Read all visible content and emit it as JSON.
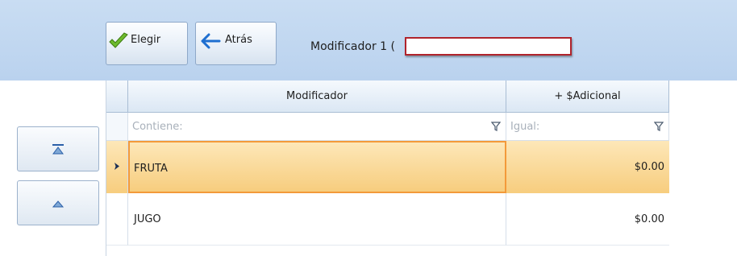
{
  "toolbar": {
    "elegir_label": "Elegir",
    "elegir_icon": "checkmark-icon",
    "atras_label": "Atrás",
    "atras_icon": "arrow-left-icon",
    "title": "Modificador 1 ("
  },
  "nav": {
    "top_icon": "move-to-top-icon",
    "up_icon": "move-up-icon"
  },
  "grid": {
    "columns": [
      "Modificador",
      "+ $Adicional"
    ],
    "filter_placeholders": [
      "Contiene:",
      "Igual:"
    ],
    "filter_icon": "funnel-icon",
    "row_indicator_icon": "current-row-arrow-icon",
    "rows": [
      {
        "modificador": "FRUTA",
        "adicional": "$0.00",
        "selected": true
      },
      {
        "modificador": "JUGO",
        "adicional": "$0.00",
        "selected": false
      }
    ]
  },
  "colors": {
    "toolbar_bg": "#bad2ee",
    "selected_row": "#f7cd7e",
    "focus_border": "#f39a3a",
    "redacted_border": "#b0232c"
  }
}
